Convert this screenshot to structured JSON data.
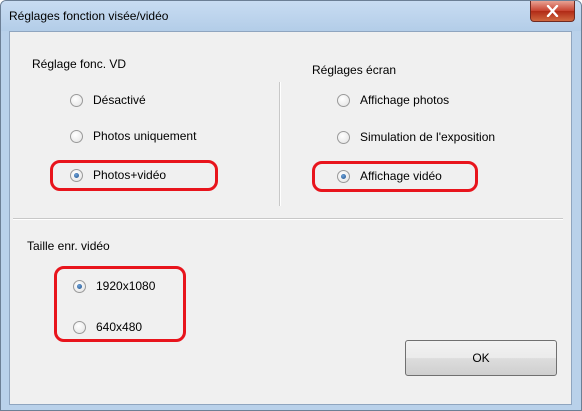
{
  "window": {
    "title": "Réglages fonction visée/vidéo",
    "close_icon": "close-icon"
  },
  "vd_group": {
    "label": "Réglage fonc. VD",
    "options": [
      {
        "label": "Désactivé",
        "checked": false
      },
      {
        "label": "Photos uniquement",
        "checked": false
      },
      {
        "label": "Photos+vidéo",
        "checked": true
      }
    ]
  },
  "screen_group": {
    "label": "Réglages écran",
    "options": [
      {
        "label": "Affichage photos",
        "checked": false
      },
      {
        "label": "Simulation de l'exposition",
        "checked": false
      },
      {
        "label": "Affichage vidéo",
        "checked": true
      }
    ]
  },
  "size_group": {
    "label": "Taille enr. vidéo",
    "options": [
      {
        "label": "1920x1080",
        "checked": true
      },
      {
        "label": "640x480",
        "checked": false
      }
    ]
  },
  "buttons": {
    "ok_label": "OK"
  },
  "colors": {
    "highlight": "#e8141c",
    "titlebar": "#b9d1ea",
    "close_button": "#c7412e"
  }
}
